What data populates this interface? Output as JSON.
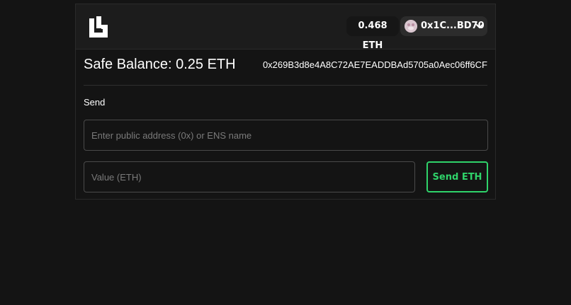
{
  "header": {
    "logo_icon": "safe-logo-icon",
    "eth_balance": "0.468 ETH",
    "account": {
      "label": "0x1C...BD70",
      "avatar_icon": "avatar-icon",
      "chevron_icon": "chevron-down-icon"
    }
  },
  "safe": {
    "balance_title": "Safe Balance: 0.25 ETH",
    "address": "0x269B3d8e4A8C72AE7EADDBAd5705a0Aec06ff6CF"
  },
  "send_form": {
    "label": "Send",
    "address_placeholder": "Enter public address (0x) or ENS name",
    "value_placeholder": "Value (ETH)",
    "submit_label": "Send ETH",
    "accent_color": "#2fd36a"
  }
}
